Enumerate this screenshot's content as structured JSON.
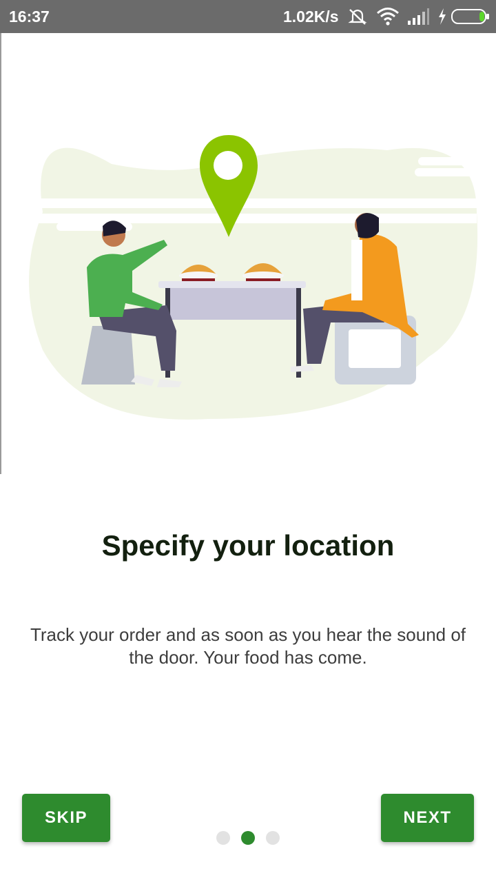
{
  "status_bar": {
    "time": "16:37",
    "network_speed": "1.02K/s",
    "icons": [
      "mute-icon",
      "wifi-icon",
      "signal-icon",
      "charging-icon",
      "battery-icon"
    ]
  },
  "onboarding": {
    "illustration": "two-people-eating-with-location-pin",
    "title": "Specify your location",
    "description": "Track your order and as soon as you hear the sound of the door. Your food has come.",
    "current_page": 2,
    "total_pages": 3
  },
  "buttons": {
    "skip_label": "SKIP",
    "next_label": "NEXT"
  },
  "colors": {
    "accent": "#2e8b2e",
    "pin": "#8bc400",
    "status_bar": "#6b6b6b",
    "title_text": "#13200f",
    "body_text": "#3d3d3d"
  }
}
